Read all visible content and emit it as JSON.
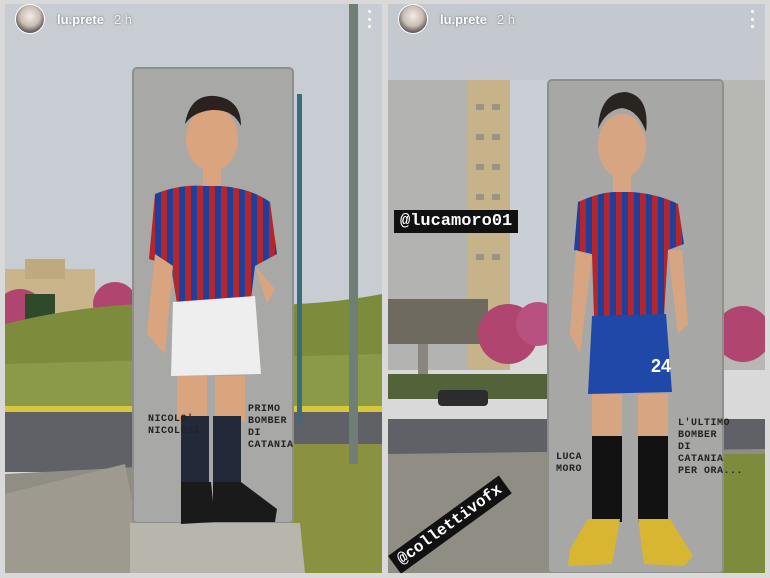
{
  "left_story": {
    "username": "lu.prete",
    "time": "2 h",
    "caption_name": "NICOLO'\nNICOLOSI",
    "caption_title": "PRIMO\nBOMBER\nDI\nCATANIA"
  },
  "right_story": {
    "username": "lu.prete",
    "time": "2 h",
    "mention_tag": "@lucamoro01",
    "sticker_tag": "@collettivofx",
    "caption_name": "LUCA\nMORO",
    "caption_title": "L'ULTIMO\nBOMBER\nDI\nCATANIA\nPER ORA...",
    "jersey_number": "24"
  },
  "colors": {
    "sky": "#c6ccd2",
    "wall": "#a8a9a6",
    "jersey_red": "#b3262d",
    "jersey_blue": "#1f3f9a",
    "blossom": "#b0456f",
    "grass": "#7d8b3c"
  },
  "icons": [
    "more-options-icon",
    "profile-avatar-icon"
  ]
}
